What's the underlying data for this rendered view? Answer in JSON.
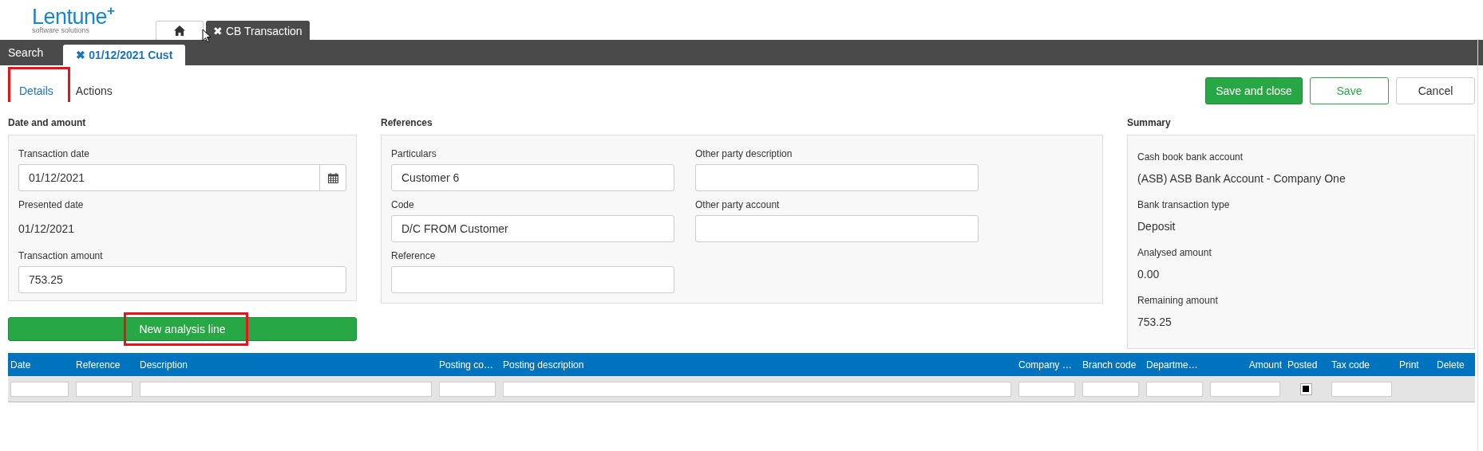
{
  "logo": {
    "name": "Lentune",
    "plus": "+",
    "tagline": "software solutions"
  },
  "app_tabs": [
    {
      "kind": "home",
      "selected": false
    },
    {
      "kind": "text",
      "close": "✖",
      "label": "CB Transaction",
      "selected": true
    }
  ],
  "sub_bar": {
    "search": "Search",
    "tabs": [
      {
        "close": "✖",
        "label": "01/12/2021 Cust",
        "selected": true
      }
    ]
  },
  "form_tabs": [
    {
      "label": "Details",
      "selected": true,
      "highlighted": true
    },
    {
      "label": "Actions",
      "selected": false,
      "highlighted": false
    }
  ],
  "buttons": [
    {
      "label": "Save and close",
      "kind": "primary"
    },
    {
      "label": "Save",
      "kind": "outline"
    },
    {
      "label": "Cancel",
      "kind": "default"
    }
  ],
  "date_and_amount": {
    "heading": "Date and amount",
    "fields": [
      {
        "label": "Transaction date",
        "value": "01/12/2021",
        "kind": "date"
      },
      {
        "label": "Presented date",
        "value": "01/12/2021",
        "kind": "text"
      },
      {
        "label": "Transaction amount",
        "value": "753.25",
        "kind": "input"
      }
    ]
  },
  "references": {
    "heading": "References",
    "fields": [
      {
        "label": "Particulars",
        "value": "Customer 6"
      },
      {
        "label": "Other party description"
      },
      {
        "label": "Code",
        "value": "D/C FROM Customer"
      },
      {
        "label": "Other party account"
      },
      {
        "label": "Reference"
      }
    ]
  },
  "summary": {
    "heading": "Summary",
    "items": [
      {
        "label": "Cash book bank account",
        "value": "(ASB) ASB Bank Account - Company One"
      },
      {
        "label": "Bank transaction type",
        "value": "Deposit"
      },
      {
        "label": "Analysed amount",
        "value": "0.00"
      },
      {
        "label": "Remaining amount",
        "value": "753.25"
      }
    ]
  },
  "new_line_button": {
    "label": "New analysis line",
    "highlighted": true
  },
  "analysis_table": {
    "columns": [
      {
        "label": "Date",
        "kind": "input"
      },
      {
        "label": "Reference",
        "kind": "input"
      },
      {
        "label": "Description",
        "kind": "input"
      },
      {
        "label": "Posting co…",
        "kind": "input"
      },
      {
        "label": "Posting description",
        "kind": "input"
      },
      {
        "label": "Company …",
        "kind": "input"
      },
      {
        "label": "Branch code",
        "kind": "input"
      },
      {
        "label": "Departme…",
        "kind": "input"
      },
      {
        "label": "Amount",
        "kind": "amount"
      },
      {
        "label": "Posted",
        "kind": "checkbox"
      },
      {
        "label": "Tax code",
        "kind": "input"
      },
      {
        "label": "Print",
        "kind": "action"
      },
      {
        "label": "Delete",
        "kind": "action"
      }
    ],
    "rows": [
      {
        "posted_checked": true
      }
    ]
  }
}
